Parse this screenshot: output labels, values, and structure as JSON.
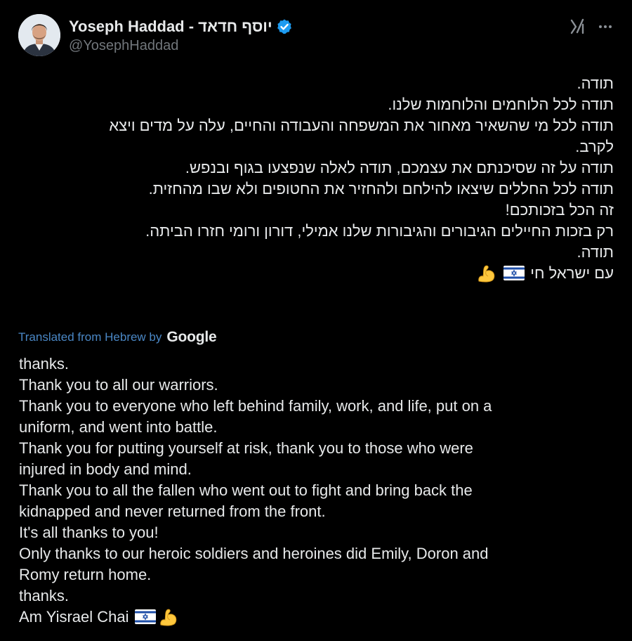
{
  "author": {
    "display_name": "יוסף חדאד - Yoseph Haddad",
    "handle": "@YosephHaddad",
    "verified": true
  },
  "icons": {
    "verified": "verified-badge-icon",
    "grok": "grok-icon",
    "more": "more-options-icon",
    "flag": "israel-flag-emoji",
    "muscle": "flexed-biceps-emoji"
  },
  "colors": {
    "background": "#000000",
    "text": "#e7e9ea",
    "secondary_text": "#71767b",
    "link": "#4a87c5",
    "verified_blue": "#1d9bf0"
  },
  "post": {
    "hebrew_lines": [
      "תודה.",
      "תודה לכל הלוחמים והלוחמות שלנו.",
      "תודה לכל מי שהשאיר מאחור את המשפחה והעבודה והחיים, עלה על מדים ויצא",
      "לקרב.",
      "תודה על זה שסיכנתם את עצמכם, תודה לאלה שנפצעו בגוף ובנפש.",
      "תודה לכל החללים שיצאו להילחם ולהחזיר את החטופים ולא שבו מהחזית.",
      "זה הכל בזכותכם!",
      "רק בזכות החיילים הגיבורים והגיבורות שלנו אמילי, דורון ורומי חזרו הביתה.",
      "תודה."
    ],
    "hebrew_last_line": "עם ישראל חי",
    "translated_label": "Translated from Hebrew by",
    "translator": "Google",
    "english_lines": [
      "thanks.",
      "Thank you to all our warriors.",
      "Thank you to everyone who left behind family, work, and life, put on a",
      "uniform, and went into battle.",
      "Thank you for putting yourself at risk, thank you to those who were",
      "injured in body and mind.",
      "Thank you to all the fallen who went out to fight and bring back the",
      "kidnapped and never returned from the front.",
      "It's all thanks to you!",
      "Only thanks to our heroic soldiers and heroines did Emily, Doron and",
      "Romy return home.",
      "thanks."
    ],
    "english_last_line": "Am Yisrael Chai"
  }
}
